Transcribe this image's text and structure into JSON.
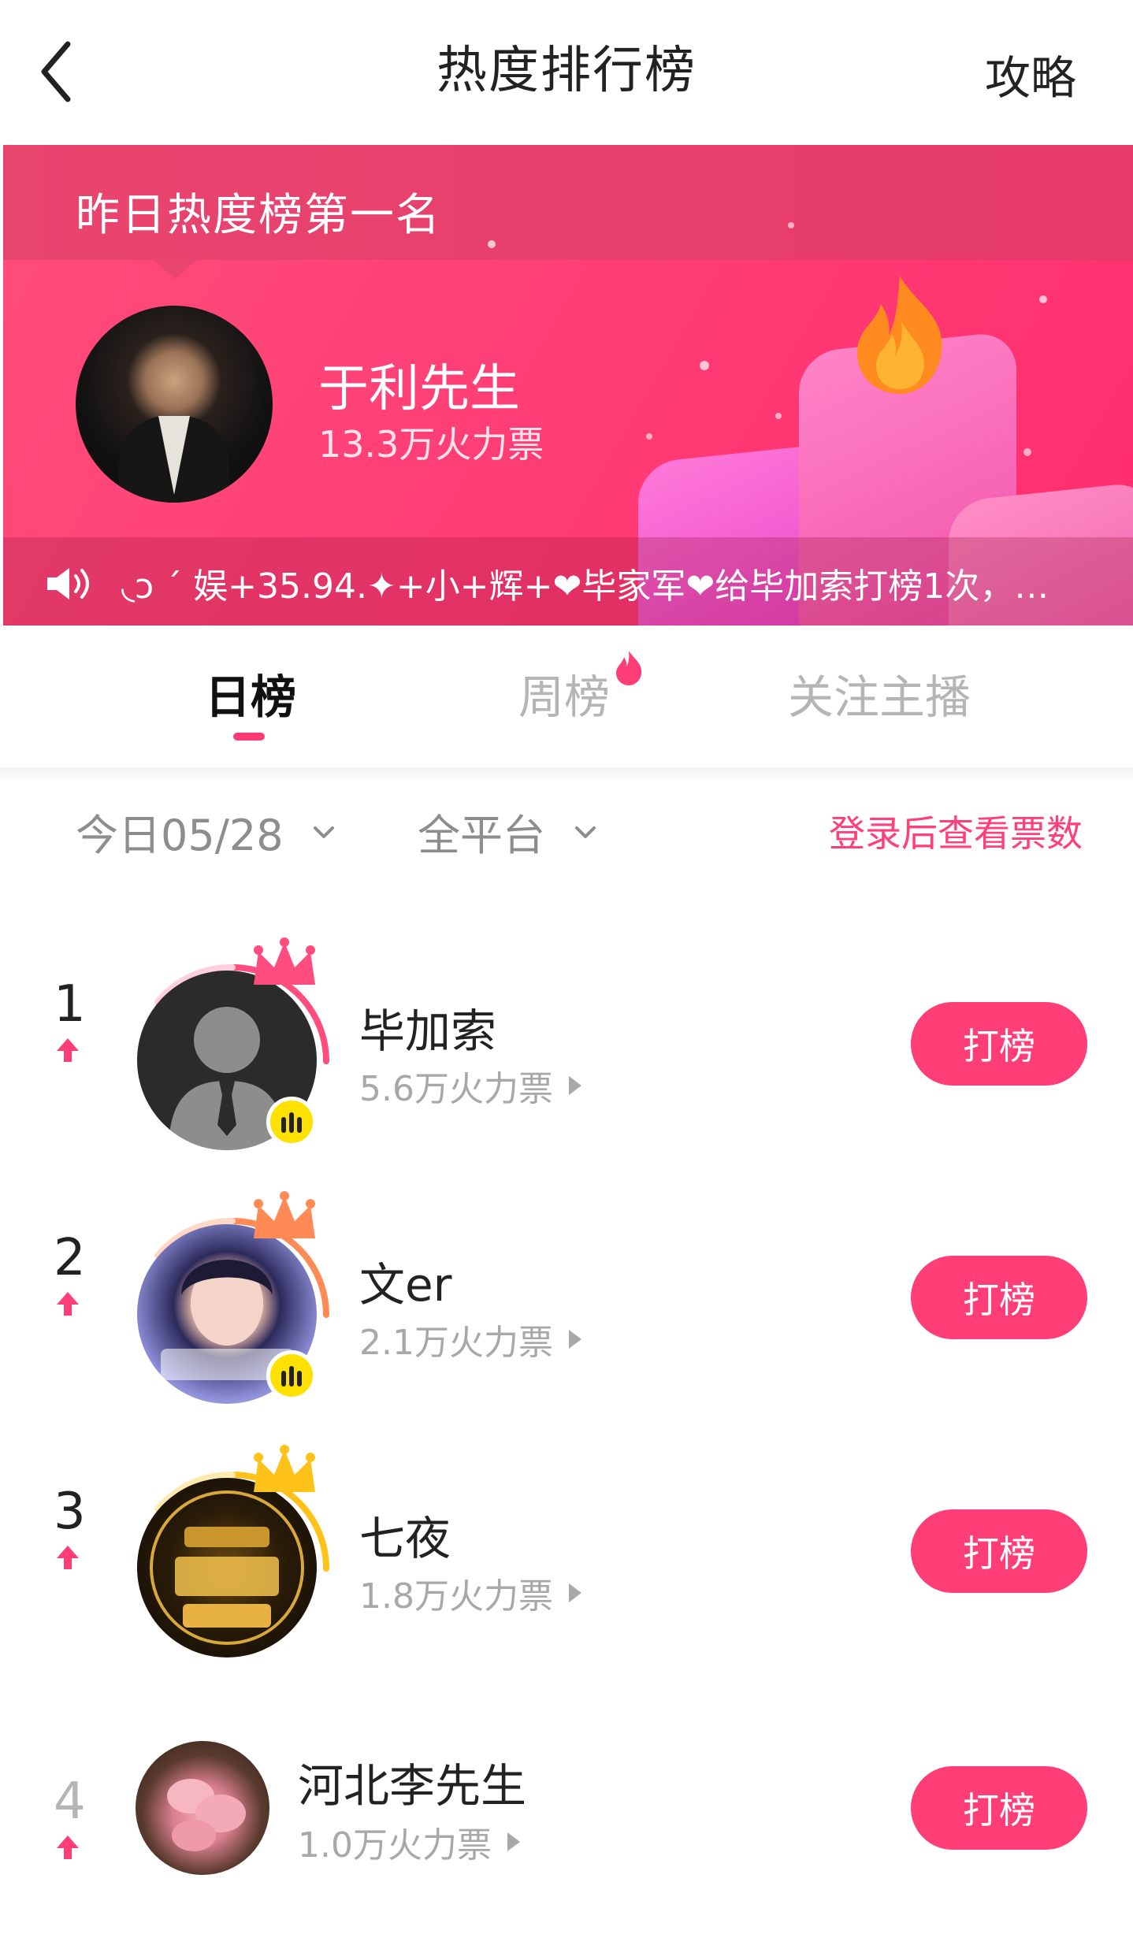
{
  "header": {
    "title": "热度排行榜",
    "strategy_label": "攻略"
  },
  "banner": {
    "caption": "昨日热度榜第一名",
    "winner_name": "于利先生",
    "winner_votes": "13.3万火力票",
    "ticker": "◟ↄ ˊ 娱+35.94.✦+小+辉+❤毕家军❤给毕加索打榜1次，…"
  },
  "tabs": [
    {
      "label": "日榜",
      "active": true
    },
    {
      "label": "周榜",
      "active": false
    },
    {
      "label": "关注主播",
      "active": false
    }
  ],
  "filters": {
    "date": "今日05/28",
    "platform": "全平台",
    "login_hint": "登录后查看票数"
  },
  "ranking": [
    {
      "rank": "1",
      "name": "毕加索",
      "votes": "5.6万火力票",
      "button": "打榜",
      "crown_color": "#ff4d7f"
    },
    {
      "rank": "2",
      "name": "文er",
      "votes": "2.1万火力票",
      "button": "打榜",
      "crown_color": "#ff8a55"
    },
    {
      "rank": "3",
      "name": "七夜",
      "votes": "1.8万火力票",
      "button": "打榜",
      "crown_color": "#ffc21a"
    },
    {
      "rank": "4",
      "name": "河北李先生",
      "votes": "1.0万火力票",
      "button": "打榜"
    }
  ],
  "colors": {
    "accent": "#ff3e77",
    "banner": "#ff4478"
  }
}
